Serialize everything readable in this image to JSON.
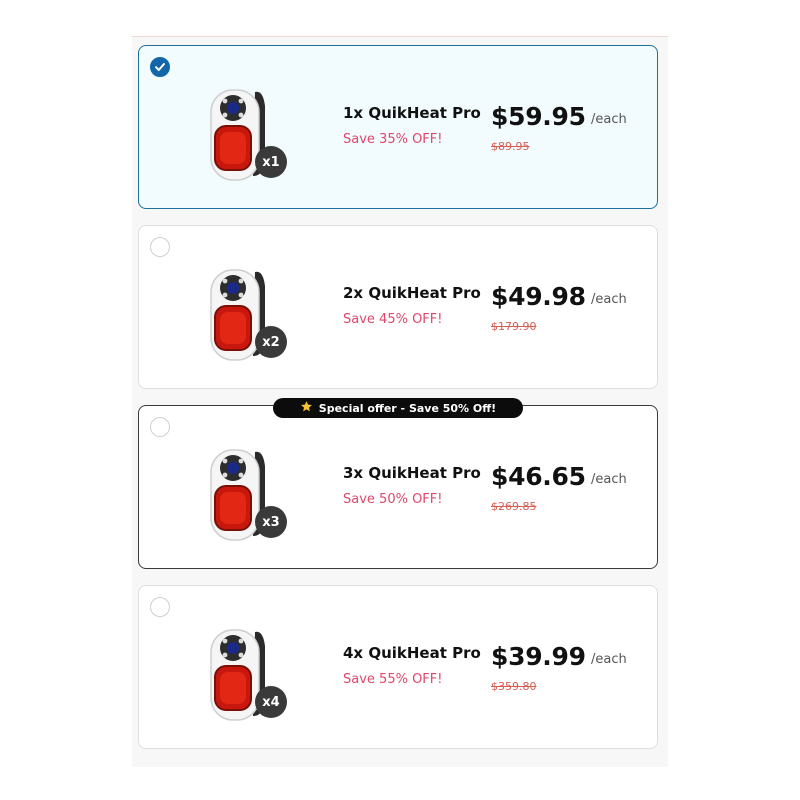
{
  "offers": [
    {
      "name": "1x QuikHeat Pro",
      "save": "Save 35% OFF!",
      "price": "$59.95",
      "each": "/each",
      "old_price": "$89.95",
      "qty": "x1",
      "selected": true
    },
    {
      "name": "2x QuikHeat Pro",
      "save": "Save 45% OFF!",
      "price": "$49.98",
      "each": "/each",
      "old_price": "$179.90",
      "qty": "x2",
      "selected": false
    },
    {
      "name": "3x QuikHeat Pro",
      "save": "Save 50% OFF!",
      "price": "$46.65",
      "each": "/each",
      "old_price": "$269.85",
      "qty": "x3",
      "selected": false
    },
    {
      "name": "4x QuikHeat Pro",
      "save": "Save 55% OFF!",
      "price": "$39.99",
      "each": "/each",
      "old_price": "$359.80",
      "qty": "x4",
      "selected": false
    }
  ],
  "special_offer": {
    "icon": "star-icon",
    "label": "Special offer - Save 50% Off!"
  },
  "colors": {
    "accent": "#1366a8",
    "save_text": "#e0476a",
    "old_price": "#d66055",
    "badge": "#3a3a3a"
  }
}
